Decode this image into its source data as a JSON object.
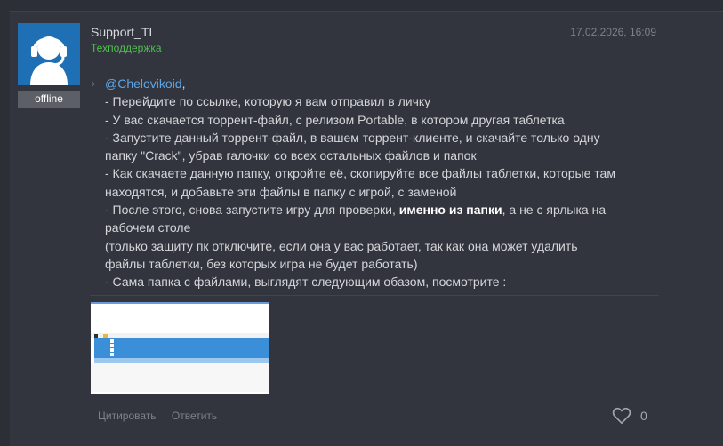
{
  "post": {
    "author": "Support_TI",
    "role": "Техподдержка",
    "status": "offline",
    "date": "17.02.2026, 16:09",
    "mention": "@Chelovikoid",
    "mention_suffix": ",",
    "lines": [
      "- Перейдите по ссылке, которую я вам отправил в личку",
      "- У вас скачается торрент-файл, с релизом Portable, в котором другая таблетка",
      "- Запустите данный торрент-файл, в вашем торрент-клиенте, и скачайте только одну",
      "папку \"Crack\", убрав галочки со всех остальных файлов и папок",
      "- Как скачаете данную папку, откройте её, скопируйте все файлы таблетки, которые там",
      "находятся, и добавьте эти файлы в папку с игрой, с заменой"
    ],
    "line7_pre": "- После этого, снова запустите игру для проверки, ",
    "line7_bold": "именно из папки",
    "line7_post": ", а не с ярлыка на",
    "lines_after": [
      "рабочем столе",
      "(только защиту пк отключите, если она у вас работает, так как она может удалить",
      "файлы таблетки, без которых игра не будет работать)",
      "- Сама папка с файлами, выглядят следующим обазом, посмотрите :"
    ],
    "attachment_files": [
      "crack",
      "steam_api64.dll",
      "steam_api64.rne",
      "steam_emu.ini",
      "steamc.dll"
    ],
    "quote_label": "Цитировать",
    "reply_label": "Ответить",
    "like_count": "0"
  },
  "colors": {
    "accent": "#5fa6e6",
    "role": "#4fbf4f",
    "avatar_bg": "#1f6fb4"
  },
  "icons": {
    "avatar": "headset-user-icon",
    "like": "heart-icon",
    "quote_marker": "chevron-right-icon"
  }
}
